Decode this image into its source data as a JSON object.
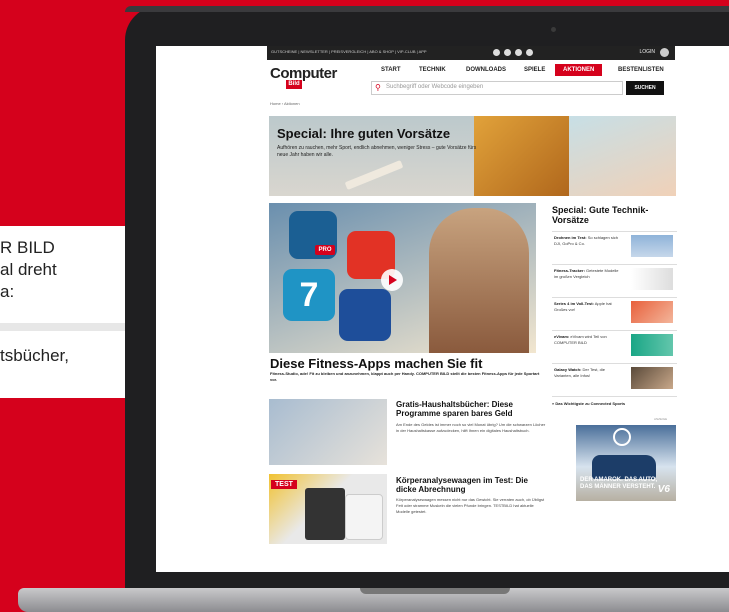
{
  "slide_text": {
    "line1": "R BILD",
    "line2": "al dreht",
    "line3": "a:",
    "line4": "tsbücher,"
  },
  "site": {
    "topbar_links": "GUTSCHEINE | NEWSLETTER | PREISVERGLEICH | ABO & SHOP | VIP-CLUB | APP",
    "login": "LOGIN",
    "logo": "Computer",
    "logo_bild": "Bild",
    "nav": [
      "START",
      "TECHNIK",
      "DOWNLOADS",
      "SPIELE",
      "AKTIONEN",
      "BESTENLISTEN"
    ],
    "search_placeholder": "Suchbegriff oder Webcode eingeben",
    "search_button": "SUCHEN",
    "breadcrumb": "Home › Aktionen"
  },
  "banner": {
    "title": "Special: Ihre guten Vorsätze",
    "subtitle": "Aufhören zu rauchen, mehr Sport, endlich abnehmen, weniger Stress – gute Vorsätze fürs neue Jahr haben wir alle."
  },
  "hero": {
    "title": "Diese Fitness-Apps machen Sie fit",
    "subtitle": "Fitness-Studio, ade! Fit zu bleiben und anzunehmen, klappt auch per Handy. COMPUTER BILD stellt die besten Fitness-Apps für jede Sportart vor.",
    "app_badge": "PRO",
    "app_number": "7"
  },
  "articles": [
    {
      "title": "Gratis-Haushaltsbücher: Diese Programme sparen bares Geld",
      "subtitle": "Am Ende des Geldes ist immer noch so viel Monat übrig? Um die schwarzen Löcher in der Haushaltskasse aufzudecken, hilft Ihnen ein digitales Haushaltsbuch."
    },
    {
      "title": "Körperanalysewaagen im Test: Die dicke Abrechnung",
      "subtitle": "Körperanalysewaagen messen nicht nur das Gewicht. Sie verraten auch, ob Übligst Fett oder stramme Muskeln die vielen Pfunde bringen. TESTBILD hat aktuelle Modelle getestet.",
      "badge": "TEST"
    }
  ],
  "sidebar": {
    "title": "Special: Gute Technik-Vorsätze",
    "items": [
      {
        "bold": "Drohnen im Test:",
        "text": "So schlagen sich DJI, GoPro & Co."
      },
      {
        "bold": "Fitness-Tracker:",
        "text": "Getestete Modelle im großen Vergleich"
      },
      {
        "bold": "Series 4 im Voll-Test:",
        "text": "Apple hat Großes vor!"
      },
      {
        "bold": "eVivam:",
        "text": "eVivam wird Teil von COMPUTER BILD"
      },
      {
        "bold": "Galaxy Watch:",
        "text": "Der Test, die Varianten, alle Infos!"
      }
    ],
    "more": "» Das Wichtigste zu Connected Sports"
  },
  "ad": {
    "label": "ANZEIGE",
    "text_line1": "DER AMAROK. DAS AUTO,",
    "text_line2": "DAS MÄNNER VERSTEHT.",
    "model": "V6"
  },
  "colors": {
    "brand_red": "#d5011c",
    "laptop_bezel": "#1f1f21"
  }
}
